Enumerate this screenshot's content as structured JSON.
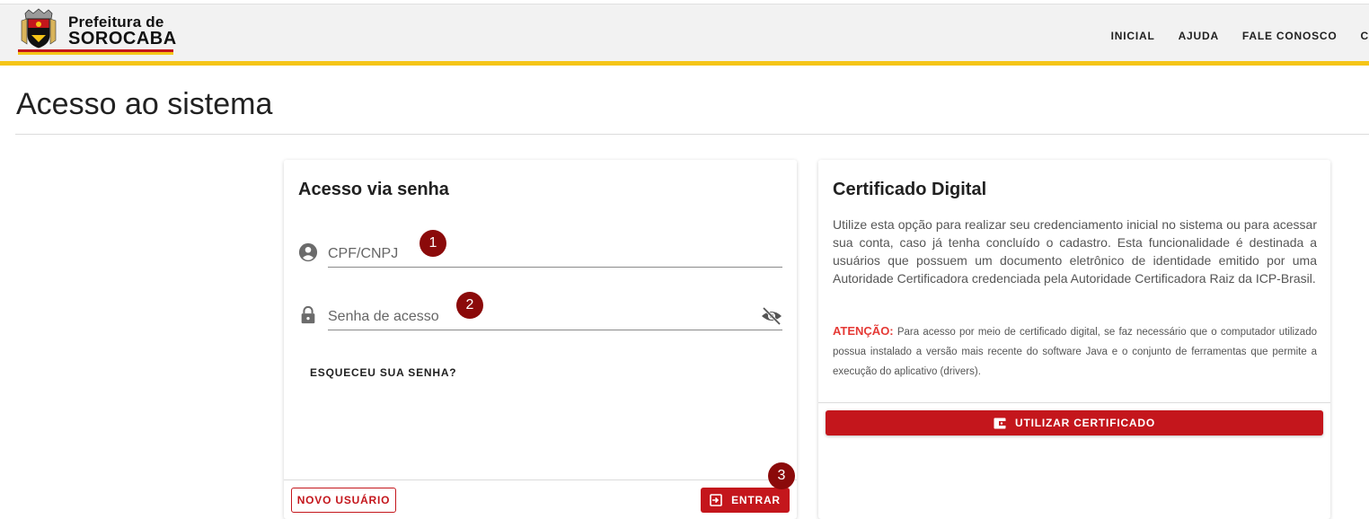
{
  "header": {
    "logo_line1": "Prefeitura de",
    "logo_line2": "SOROCABA",
    "nav": [
      {
        "label": "INICIAL"
      },
      {
        "label": "AJUDA"
      },
      {
        "label": "FALE CONOSCO"
      },
      {
        "label": "C"
      }
    ]
  },
  "page": {
    "title": "Acesso ao sistema"
  },
  "login_card": {
    "title": "Acesso via senha",
    "cpf_placeholder": "CPF/CNPJ",
    "senha_placeholder": "Senha de acesso",
    "forgot_label": "ESQUECEU SUA SENHA?",
    "novo_usuario_label": "NOVO USUÁRIO",
    "entrar_label": "ENTRAR"
  },
  "badges": [
    "1",
    "2",
    "3"
  ],
  "cert_card": {
    "title": "Certificado Digital",
    "description": "Utilize esta opção para realizar seu credenciamento inicial no sistema ou para acessar sua conta, caso já tenha concluído o cadastro. Esta funcionalidade é destinada a usuários que possuem um documento eletrônico de identidade emitido por uma Autoridade Certificadora credenciada pela Autoridade Certificadora Raiz da ICP-Brasil.",
    "warning_label": "ATENÇÃO:",
    "warning_text": " Para acesso por meio de certificado digital, se faz necessário que o computador utilizado possua instalado a versão mais recente do software Java e o conjunto de ferramentas que permite a execução do aplicativo (drivers).",
    "button_label": "UTILIZAR CERTIFICADO"
  },
  "colors": {
    "brand_red": "#c4161c",
    "brand_yellow": "#f5c518",
    "badge": "#8b0a0a",
    "warning": "#e53935"
  }
}
